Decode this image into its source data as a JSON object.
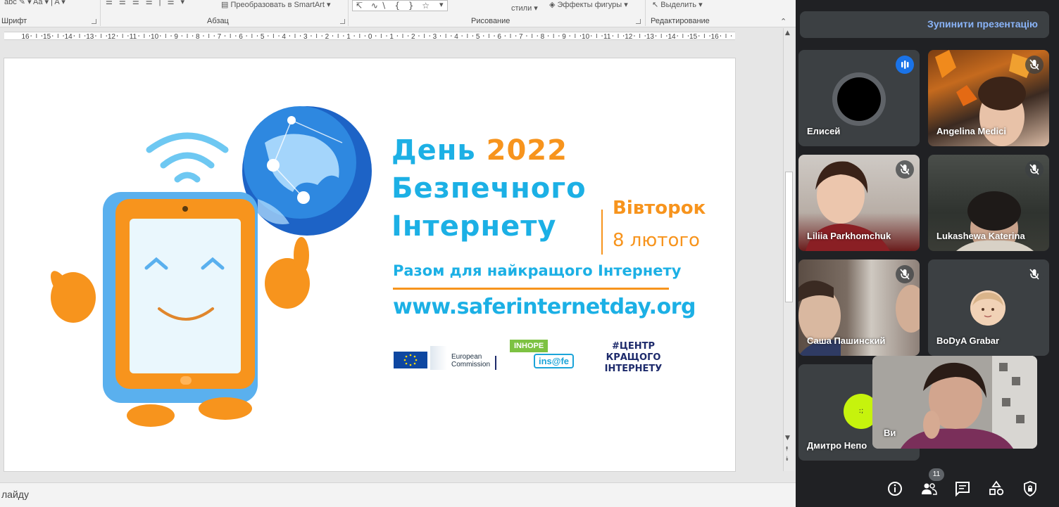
{
  "ribbon": {
    "font_group": "Шрифт",
    "paragraph_group": "Абзац",
    "convert_smartart": "Преобразовать в SmartArt",
    "drawing_group": "Рисование",
    "styles_label": "стили",
    "shape_effects": "Эффекты фигуры",
    "select_label": "Выделить",
    "editing_group": "Редактирование"
  },
  "ruler": {
    "labels": [
      "16",
      "15",
      "14",
      "13",
      "12",
      "11",
      "10",
      "9",
      "8",
      "7",
      "6",
      "5",
      "4",
      "3",
      "2",
      "1",
      "0",
      "1",
      "2",
      "3",
      "4",
      "5",
      "6",
      "7",
      "8",
      "9",
      "10",
      "11",
      "12",
      "13",
      "14",
      "15",
      "16"
    ]
  },
  "slide": {
    "title_line1_word": "День",
    "title_line1_year": "2022",
    "title_line2": "Безпечного",
    "title_line3": "Інтернету",
    "day": "Вівторок",
    "date": "8 лютого",
    "tagline": "Разом для найкращого Інтернету",
    "url": "www.saferinternetday.org",
    "ec_line1": "European",
    "ec_line2": "Commission",
    "inhope": "INHOPE",
    "insafe": "ins@fe",
    "centr_line1": "#ЦЕНТР",
    "centr_line2": "КРАЩОГО",
    "centr_line3": "ІНТЕРНЕТУ",
    "colors": {
      "blue": "#1cb0e5",
      "orange": "#f7941d",
      "navy": "#1d2a6b"
    }
  },
  "statusbar": {
    "text": "лайду"
  },
  "meet": {
    "stop_presenting": "Зупинити презентацію",
    "participants": [
      {
        "name": "Елисей",
        "state": "speaking"
      },
      {
        "name": "Angelina Medici",
        "state": "muted"
      },
      {
        "name": "Liliia Parkhomchuk",
        "state": "muted"
      },
      {
        "name": "Lukashewa Katerina",
        "state": "muted"
      },
      {
        "name": "Саша Пашинский",
        "state": "muted"
      },
      {
        "name": "BoDyA Grabar",
        "state": "muted"
      },
      {
        "name": "Дмитро Непо",
        "state": "none"
      }
    ],
    "self_label": "Ви",
    "participant_count": "11",
    "controls": [
      "info-icon",
      "people-icon",
      "chat-icon",
      "activities-icon",
      "host-controls-icon"
    ],
    "colors": {
      "accent": "#8ab4f8",
      "bg": "#202124",
      "tile": "#3c4043",
      "speaking": "#1a73e8"
    }
  }
}
